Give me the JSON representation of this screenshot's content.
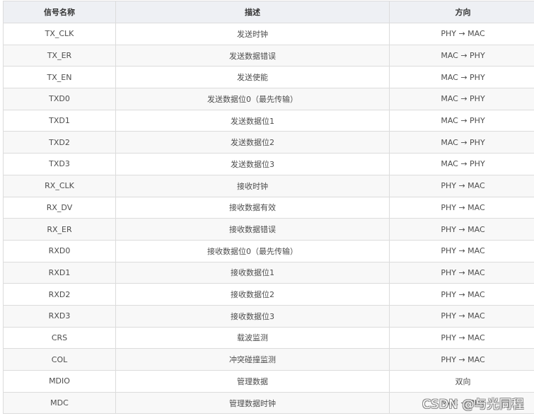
{
  "table": {
    "headers": [
      "信号名称",
      "描述",
      "方向"
    ],
    "rows": [
      [
        "TX_CLK",
        "发送时钟",
        "PHY → MAC"
      ],
      [
        "TX_ER",
        "发送数据错误",
        "MAC → PHY"
      ],
      [
        "TX_EN",
        "发送使能",
        "MAC → PHY"
      ],
      [
        "TXD0",
        "发送数据位0（最先传输）",
        "MAC → PHY"
      ],
      [
        "TXD1",
        "发送数据位1",
        "MAC → PHY"
      ],
      [
        "TXD2",
        "发送数据位2",
        "MAC → PHY"
      ],
      [
        "TXD3",
        "发送数据位3",
        "MAC → PHY"
      ],
      [
        "RX_CLK",
        "接收时钟",
        "PHY → MAC"
      ],
      [
        "RX_DV",
        "接收数据有效",
        "PHY → MAC"
      ],
      [
        "RX_ER",
        "接收数据错误",
        "PHY → MAC"
      ],
      [
        "RXD0",
        "接收数据位0（最先传输）",
        "PHY → MAC"
      ],
      [
        "RXD1",
        "接收数据位1",
        "PHY → MAC"
      ],
      [
        "RXD2",
        "接收数据位2",
        "PHY → MAC"
      ],
      [
        "RXD3",
        "接收数据位3",
        "PHY → MAC"
      ],
      [
        "CRS",
        "载波监测",
        "PHY → MAC"
      ],
      [
        "COL",
        "冲突碰撞监测",
        "PHY → MAC"
      ],
      [
        "MDIO",
        "管理数据",
        "双向"
      ],
      [
        "MDC",
        "管理数据时钟",
        "MAC → PHY"
      ]
    ]
  },
  "watermark": "CSDN @与光同程"
}
